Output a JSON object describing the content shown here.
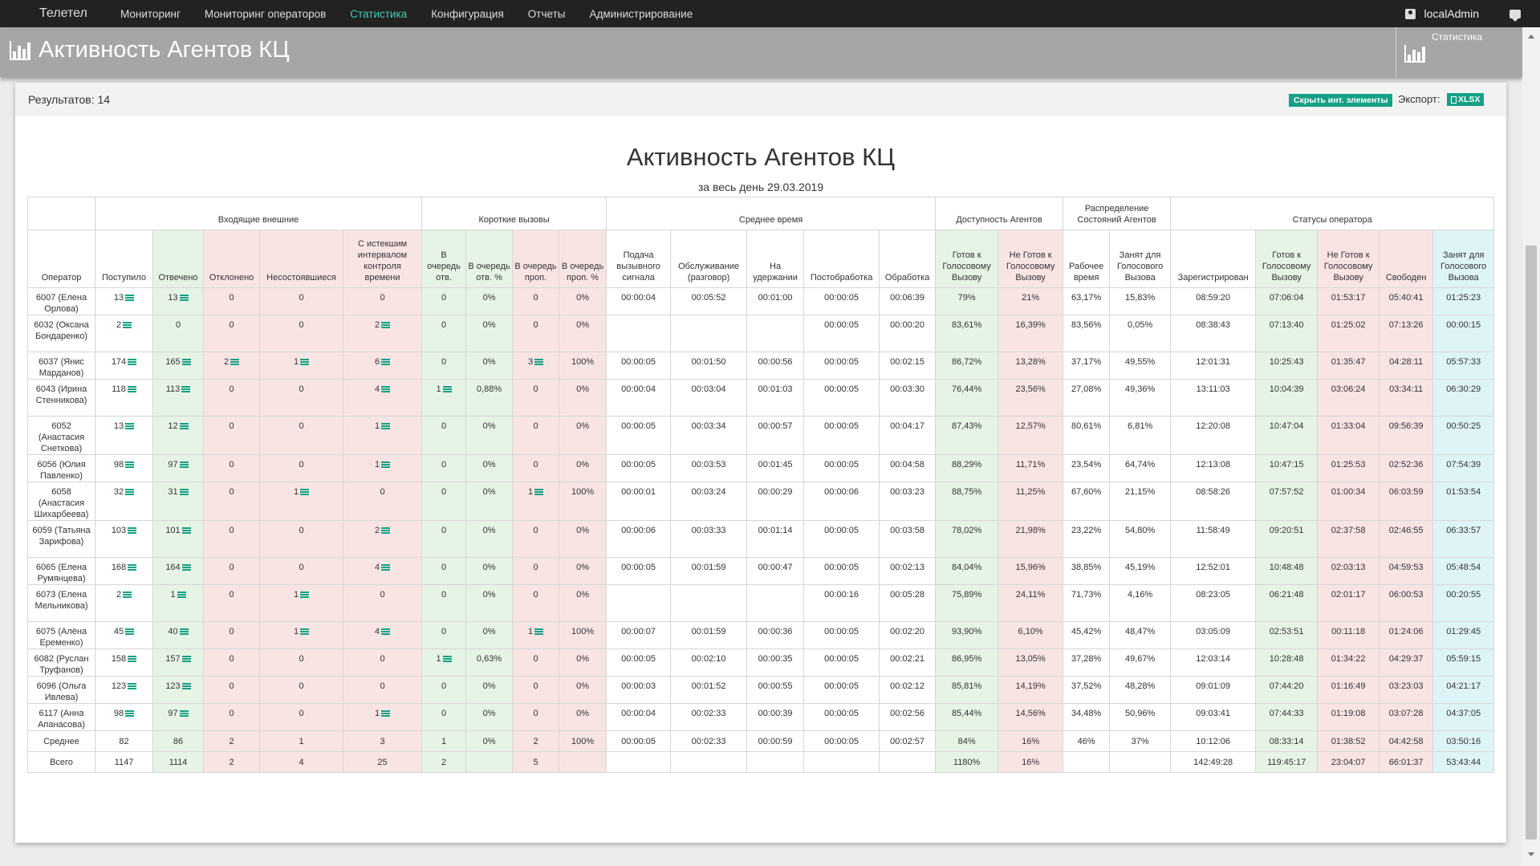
{
  "navbar": {
    "brand": "Телетел",
    "items": [
      {
        "label": "Мониторинг",
        "active": false
      },
      {
        "label": "Мониторинг операторов",
        "active": false
      },
      {
        "label": "Статистика",
        "active": true
      },
      {
        "label": "Конфигурация",
        "active": false
      },
      {
        "label": "Отчеты",
        "active": false
      },
      {
        "label": "Администрирование",
        "active": false
      }
    ],
    "user": "localAdmin",
    "user_icon": "user-icon",
    "chat_icon": "chat-icon"
  },
  "header": {
    "title": "Активность Агентов КЦ",
    "tile_label": "Статистика",
    "icon": "bar-chart-icon"
  },
  "panel": {
    "results": "Результатов: 14",
    "hide_button": "Скрыть инт. элементы",
    "export_label": "Экспорт:",
    "xlsx_button": "XLSX"
  },
  "report": {
    "title": "Активность Агентов КЦ",
    "subtitle": "за весь день 29.03.2019"
  },
  "colors": {
    "accent": "#16a085",
    "active_nav": "#3fcfb4",
    "green_cell": "#e6f4e6",
    "red_cell": "#f9e4e4",
    "blue_cell": "#dff4f7"
  },
  "table": {
    "groups": [
      "",
      "Входящие внешние",
      "Короткие вызовы",
      "Среднее время",
      "Доступность Агентов",
      "Распределение Состояний Агентов",
      "Статусы оператора"
    ],
    "columns": [
      "Оператор",
      "Поступило",
      "Отвечено",
      "Отклонено",
      "Несостоявшиеся",
      "С истекшим интервалом контроля времени",
      "В очередь отв.",
      "В очередь отв. %",
      "В очередь проп.",
      "В очередь проп. %",
      "Подача вызывного сигнала",
      "Обслуживание (разговор)",
      "На удержании",
      "Постобработка",
      "Обработка",
      "Готов к Голосовому Вызову",
      "Не Готов к Голосовому Вызову",
      "Рабочее время",
      "Занят для Голосового Вызова",
      "Зарегистрирован",
      "Готов к Голосовому Вызову",
      "Не Готов к Голосовому Вызову",
      "Свободен",
      "Занят для Голосового Вызова"
    ],
    "rows": [
      [
        "6007 (Елена Орлова)",
        "13",
        "13",
        "0",
        "0",
        "0",
        "0",
        "0%",
        "0",
        "0%",
        "00:00:04",
        "00:05:52",
        "00:01:00",
        "00:00:05",
        "00:06:39",
        "79%",
        "21%",
        "63,17%",
        "15,83%",
        "08:59:20",
        "07:06:04",
        "01:53:17",
        "05:40:41",
        "01:25:23"
      ],
      [
        "6032 (Оксана Бондаренко)",
        "2",
        "0",
        "0",
        "0",
        "2",
        "0",
        "0%",
        "0",
        "0%",
        "",
        "",
        "",
        "00:00:05",
        "00:00:20",
        "83,61%",
        "16,39%",
        "83,56%",
        "0,05%",
        "08:38:43",
        "07:13:40",
        "01:25:02",
        "07:13:26",
        "00:00:15"
      ],
      [
        "6037 (Янис Марданов)",
        "174",
        "165",
        "2",
        "1",
        "6",
        "0",
        "0%",
        "3",
        "100%",
        "00:00:05",
        "00:01:50",
        "00:00:56",
        "00:00:05",
        "00:02:15",
        "86,72%",
        "13,28%",
        "37,17%",
        "49,55%",
        "12:01:31",
        "10:25:43",
        "01:35:47",
        "04:28:11",
        "05:57:33"
      ],
      [
        "6043 (Ирина Стенникова)",
        "118",
        "113",
        "0",
        "0",
        "4",
        "1",
        "0,88%",
        "0",
        "0%",
        "00:00:04",
        "00:03:04",
        "00:01:03",
        "00:00:05",
        "00:03:30",
        "76,44%",
        "23,56%",
        "27,08%",
        "49,36%",
        "13:11:03",
        "10:04:39",
        "03:06:24",
        "03:34:11",
        "06:30:29"
      ],
      [
        "6052 (Анастасия Снеткова)",
        "13",
        "12",
        "0",
        "0",
        "1",
        "0",
        "0%",
        "0",
        "0%",
        "00:00:05",
        "00:03:34",
        "00:00:57",
        "00:00:05",
        "00:04:17",
        "87,43%",
        "12,57%",
        "80,61%",
        "6,81%",
        "12:20:08",
        "10:47:04",
        "01:33:04",
        "09:56:39",
        "00:50:25"
      ],
      [
        "6056 (Юлия Павленко)",
        "98",
        "97",
        "0",
        "0",
        "1",
        "0",
        "0%",
        "0",
        "0%",
        "00:00:05",
        "00:03:53",
        "00:01:45",
        "00:00:05",
        "00:04:58",
        "88,29%",
        "11,71%",
        "23,54%",
        "64,74%",
        "12:13:08",
        "10:47:15",
        "01:25:53",
        "02:52:36",
        "07:54:39"
      ],
      [
        "6058 (Анастасия Шихарбеева)",
        "32",
        "31",
        "0",
        "1",
        "0",
        "0",
        "0%",
        "1",
        "100%",
        "00:00:01",
        "00:03:24",
        "00:00:29",
        "00:00:06",
        "00:03:23",
        "88,75%",
        "11,25%",
        "67,60%",
        "21,15%",
        "08:58:26",
        "07:57:52",
        "01:00:34",
        "06:03:59",
        "01:53:54"
      ],
      [
        "6059 (Татьяна Зарифова)",
        "103",
        "101",
        "0",
        "0",
        "2",
        "0",
        "0%",
        "0",
        "0%",
        "00:00:06",
        "00:03:33",
        "00:01:14",
        "00:00:05",
        "00:03:58",
        "78,02%",
        "21,98%",
        "23,22%",
        "54,80%",
        "11:58:49",
        "09:20:51",
        "02:37:58",
        "02:46:55",
        "06:33:57"
      ],
      [
        "6065 (Елена Румянцева)",
        "168",
        "164",
        "0",
        "0",
        "4",
        "0",
        "0%",
        "0",
        "0%",
        "00:00:05",
        "00:01:59",
        "00:00:47",
        "00:00:05",
        "00:02:13",
        "84,04%",
        "15,96%",
        "38,85%",
        "45,19%",
        "12:52:01",
        "10:48:48",
        "02:03:13",
        "04:59:53",
        "05:48:54"
      ],
      [
        "6073 (Елена Мельникова)",
        "2",
        "1",
        "0",
        "1",
        "0",
        "0",
        "0%",
        "0",
        "0%",
        "",
        "",
        "",
        "00:00:16",
        "00:05:28",
        "75,89%",
        "24,11%",
        "71,73%",
        "4,16%",
        "08:23:05",
        "06:21:48",
        "02:01:17",
        "06:00:53",
        "00:20:55"
      ],
      [
        "6075 (Алёна Еременко)",
        "45",
        "40",
        "0",
        "1",
        "4",
        "0",
        "0%",
        "1",
        "100%",
        "00:00:07",
        "00:01:59",
        "00:00:36",
        "00:00:05",
        "00:02:20",
        "93,90%",
        "6,10%",
        "45,42%",
        "48,47%",
        "03:05:09",
        "02:53:51",
        "00:11:18",
        "01:24:06",
        "01:29:45"
      ],
      [
        "6082 (Руслан Труфанов)",
        "158",
        "157",
        "0",
        "0",
        "0",
        "1",
        "0,63%",
        "0",
        "0%",
        "00:00:05",
        "00:02:10",
        "00:00:35",
        "00:00:05",
        "00:02:21",
        "86,95%",
        "13,05%",
        "37,28%",
        "49,67%",
        "12:03:14",
        "10:28:48",
        "01:34:22",
        "04:29:37",
        "05:59:15"
      ],
      [
        "6096 (Ольга Ивлева)",
        "123",
        "123",
        "0",
        "0",
        "0",
        "0",
        "0%",
        "0",
        "0%",
        "00:00:03",
        "00:01:52",
        "00:00:55",
        "00:00:05",
        "00:02:12",
        "85,81%",
        "14,19%",
        "37,52%",
        "48,28%",
        "09:01:09",
        "07:44:20",
        "01:16:49",
        "03:23:03",
        "04:21:17"
      ],
      [
        "6117 (Анна Апанасова)",
        "98",
        "97",
        "0",
        "0",
        "1",
        "0",
        "0%",
        "0",
        "0%",
        "00:00:04",
        "00:02:33",
        "00:00:39",
        "00:00:05",
        "00:02:56",
        "85,44%",
        "14,56%",
        "34,48%",
        "50,96%",
        "09:03:41",
        "07:44:33",
        "01:19:08",
        "03:07:28",
        "04:37:05"
      ]
    ],
    "summary": [
      [
        "Среднее",
        "82",
        "86",
        "2",
        "1",
        "3",
        "1",
        "0%",
        "2",
        "100%",
        "00:00:05",
        "00:02:33",
        "00:00:59",
        "00:00:05",
        "00:02:57",
        "84%",
        "16%",
        "46%",
        "37%",
        "10:12:06",
        "08:33:14",
        "01:38:52",
        "04:42:58",
        "03:50:16"
      ],
      [
        "Всего",
        "1147",
        "1114",
        "2",
        "4",
        "25",
        "2",
        "",
        "5",
        "",
        "",
        "",
        "",
        "",
        "",
        "1180%",
        "16%",
        "",
        "",
        "142:49:28",
        "119:45:17",
        "23:04:07",
        "66:01:37",
        "53:43:44"
      ]
    ]
  }
}
